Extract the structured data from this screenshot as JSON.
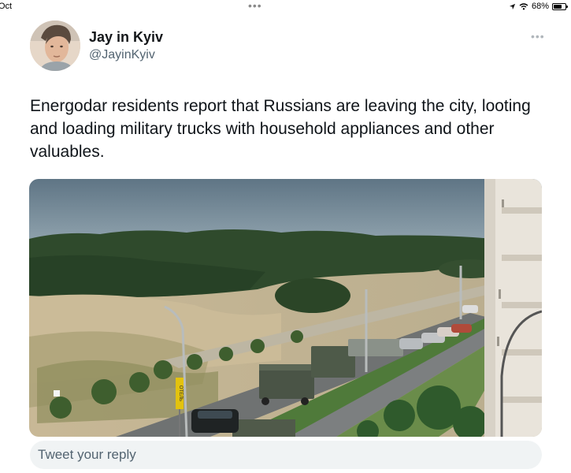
{
  "status_bar": {
    "time": "Oct",
    "battery": "68%",
    "battery_level": 0.68,
    "icons": [
      "location-arrow-icon",
      "wifi-icon",
      "battery-icon"
    ]
  },
  "tweet": {
    "author_name": "Jay in Kyiv",
    "author_handle": "@JayinKyiv",
    "text": "Energodar residents report  that Russians are leaving the city, looting and loading military trucks with household appliances and other valuables.",
    "more_icon": "more-horizontal-icon",
    "media": {
      "sign_text": "ОТЕЛЬ"
    }
  },
  "reply_bar": {
    "placeholder": "Tweet your reply"
  }
}
